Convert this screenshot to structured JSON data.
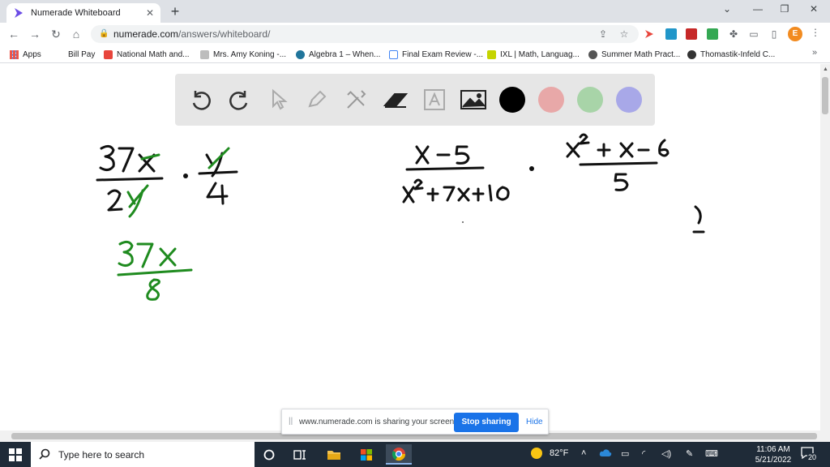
{
  "browser": {
    "tab_title": "Numerade Whiteboard",
    "tab_close": "✕",
    "new_tab": "+",
    "window_controls": [
      "⌄",
      "—",
      "❐",
      "✕"
    ],
    "nav": {
      "back": "←",
      "forward": "→",
      "reload": "↻",
      "home": "⌂"
    },
    "url_host": "numerade.com",
    "url_path": "/answers/whiteboard/",
    "avatar_letter": "E",
    "menu": "⋮"
  },
  "bookmarks": {
    "items": [
      {
        "label": "Apps",
        "color": "#4285f4"
      },
      {
        "label": "Bill Pay",
        "color": "#ffffff"
      },
      {
        "label": "National Math and...",
        "color": "#e8453c"
      },
      {
        "label": "Mrs. Amy Koning -...",
        "color": "#9aa0a6"
      },
      {
        "label": "Algebra 1 – When...",
        "color": "#21759b"
      },
      {
        "label": "Final Exam Review -...",
        "color": "#4285f4"
      },
      {
        "label": "IXL | Math, Languag...",
        "color": "#c5d400"
      },
      {
        "label": "Summer Math Pract...",
        "color": "#555555"
      },
      {
        "label": "Thomastik-Infeld C...",
        "color": "#333333"
      }
    ],
    "more": "»"
  },
  "whiteboard": {
    "tools": [
      "undo-icon",
      "redo-icon",
      "pointer-icon",
      "pen-icon",
      "tools-icon",
      "eraser-icon",
      "text-icon",
      "image-icon"
    ],
    "colors": [
      "#000000",
      "#e8a8a8",
      "#a8d4a8",
      "#a8a8e8"
    ]
  },
  "sharebar": {
    "grip": "||",
    "message": "www.numerade.com is sharing your screen.",
    "stop_label": "Stop sharing",
    "hide_label": "Hide"
  },
  "taskbar": {
    "search_placeholder": "Type here to search",
    "weather": "82°F",
    "time": "11:06 AM",
    "date": "5/21/2022",
    "notification_count": "20"
  }
}
